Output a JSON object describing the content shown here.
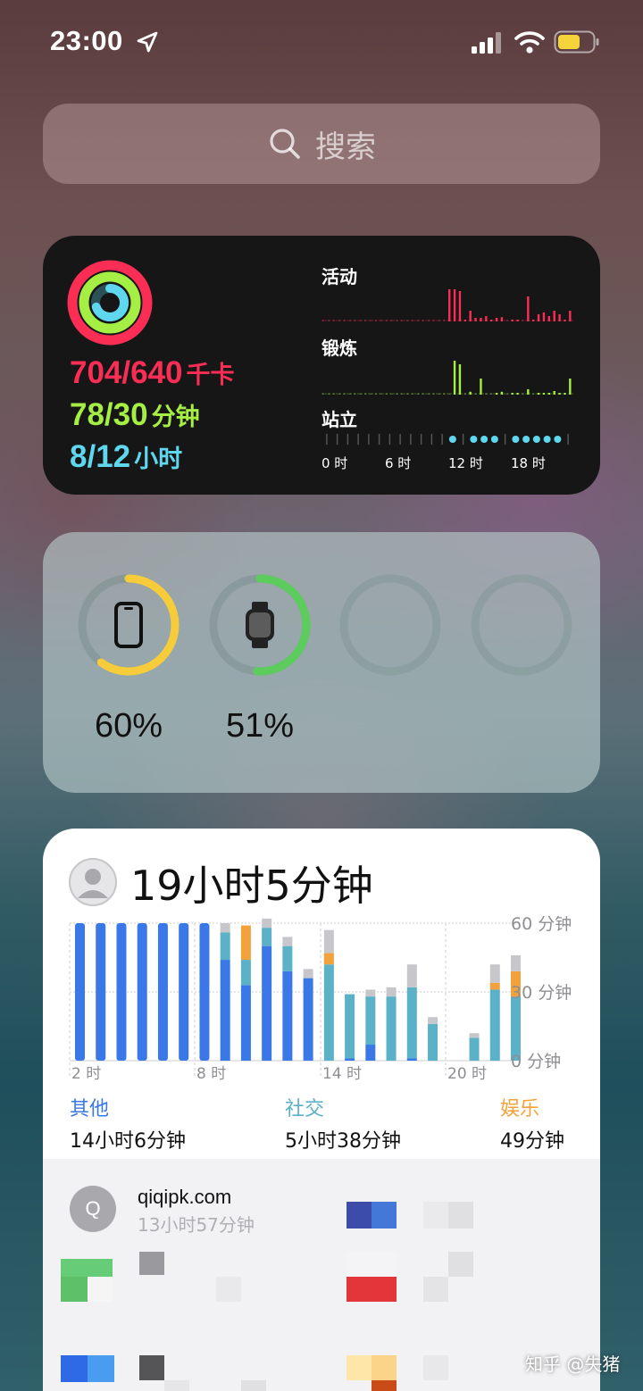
{
  "status_bar": {
    "time": "23:00"
  },
  "search": {
    "label": "搜索"
  },
  "fitness": {
    "move": {
      "value": "704/640",
      "unit": "千卡",
      "color": "#fa2d55"
    },
    "exercise": {
      "value": "78/30",
      "unit": "分钟",
      "color": "#a5ee44"
    },
    "stand": {
      "value": "8/12",
      "unit": "小时",
      "color": "#5fd8ef"
    },
    "charts": {
      "move_label": "活动",
      "exercise_label": "锻炼",
      "stand_label": "站立",
      "x_ticks": [
        "0 时",
        "6 时",
        "12 时",
        "18 时"
      ]
    }
  },
  "batteries": [
    {
      "device": "phone-icon",
      "percent_label": "60%",
      "level": 0.6,
      "color": "#f6cc3b"
    },
    {
      "device": "watch-icon",
      "percent_label": "51%",
      "level": 0.51,
      "color": "#5ccc5c"
    },
    {
      "device": "empty",
      "percent_label": "",
      "level": 0
    },
    {
      "device": "empty",
      "percent_label": "",
      "level": 0
    }
  ],
  "screentime": {
    "total": "19小时5分钟",
    "y_ticks": [
      "60 分钟",
      "30 分钟",
      "0 分钟"
    ],
    "x_ticks": [
      "2 时",
      "8 时",
      "14 时",
      "20 时"
    ],
    "categories": [
      {
        "name": "其他",
        "time": "14小时6分钟",
        "color": "#3a78e8"
      },
      {
        "name": "社交",
        "time": "5小时38分钟",
        "color": "#5bb1c8"
      },
      {
        "name": "娱乐",
        "time": "49分钟",
        "color": "#f2a23a"
      }
    ],
    "apps": [
      {
        "initial": "Q",
        "name": "qiqipk.com",
        "time": "13小时57分钟"
      }
    ]
  },
  "watermark": "知乎 @失猪",
  "chart_data": {
    "type": "bar",
    "title": "19小时5分钟",
    "ylim": [
      0,
      60
    ],
    "x_ticks": [
      "2 时",
      "8 时",
      "14 时",
      "20 时"
    ],
    "y_ticks": [
      "60 分钟",
      "30 分钟",
      "0 分钟"
    ],
    "categories": [
      "0",
      "1",
      "2",
      "3",
      "4",
      "5",
      "6",
      "7",
      "8",
      "9",
      "10",
      "11",
      "12",
      "13",
      "14",
      "15",
      "16",
      "17",
      "18",
      "19",
      "20",
      "21",
      "22"
    ],
    "series": [
      {
        "name": "其他",
        "values": [
          60,
          60,
          60,
          60,
          60,
          60,
          60,
          44,
          33,
          50,
          39,
          36,
          0,
          1,
          7,
          0,
          1,
          0,
          0,
          0,
          0,
          0,
          0
        ]
      },
      {
        "name": "社交",
        "values": [
          0,
          0,
          0,
          0,
          0,
          0,
          0,
          12,
          11,
          8,
          11,
          0,
          42,
          28,
          21,
          28,
          31,
          16,
          0,
          10,
          31,
          28,
          0
        ]
      },
      {
        "name": "娱乐",
        "values": [
          0,
          0,
          0,
          0,
          0,
          0,
          0,
          0,
          15,
          0,
          0,
          0,
          5,
          0,
          0,
          0,
          0,
          0,
          0,
          0,
          3,
          11,
          0
        ]
      },
      {
        "name": "",
        "values": [
          0,
          0,
          0,
          0,
          0,
          0,
          0,
          4,
          0,
          4,
          4,
          4,
          10,
          0,
          3,
          4,
          10,
          3,
          0,
          2,
          8,
          7,
          0
        ]
      }
    ]
  }
}
